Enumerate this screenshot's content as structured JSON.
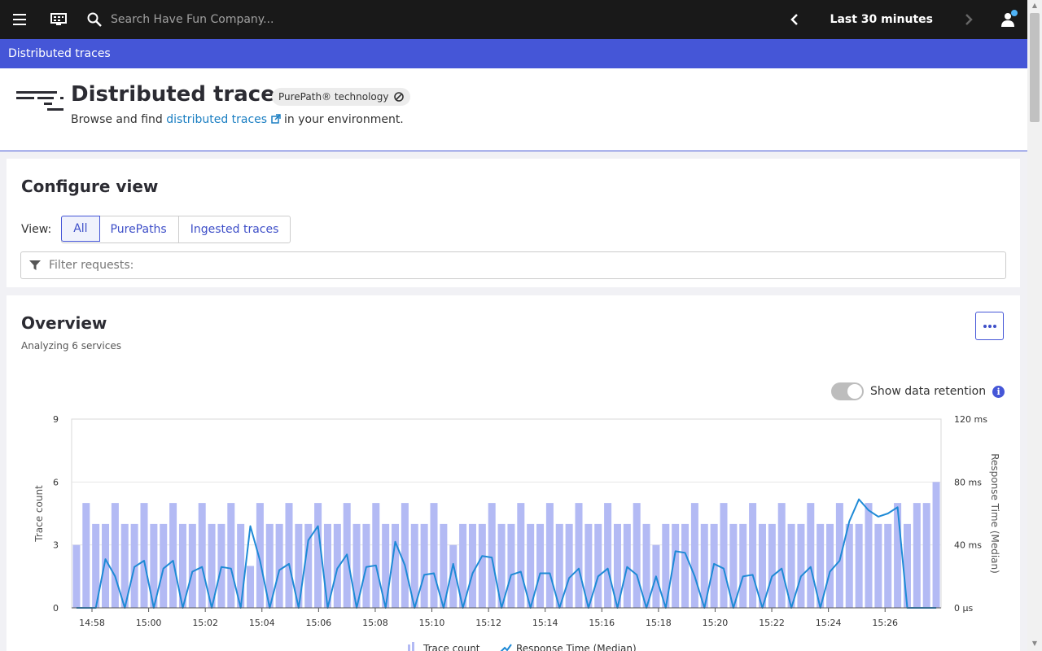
{
  "topbar": {
    "search_placeholder": "Search Have Fun Company...",
    "timeframe": "Last 30 minutes"
  },
  "breadcrumb": {
    "current": "Distributed traces"
  },
  "header": {
    "title": "Distributed traces",
    "badge": "PurePath® technology",
    "subtitle_before": "Browse and find",
    "subtitle_link": "distributed traces",
    "subtitle_after": "in your environment."
  },
  "configure": {
    "title": "Configure view",
    "view_label": "View:",
    "view_options": [
      "All",
      "PurePaths",
      "Ingested traces"
    ],
    "selected": "All",
    "filter_placeholder": "Filter requests:"
  },
  "overview": {
    "title": "Overview",
    "subtitle": "Analyzing 6 services",
    "toggle_label": "Show data retention",
    "toggle_on": false
  },
  "chart_data": {
    "type": "bar",
    "ylabel": "Trace count",
    "y2label": "Response Time (Median)",
    "ylim": [
      0,
      9
    ],
    "yticks": [
      "0",
      "3",
      "6",
      "9"
    ],
    "y2ticks": [
      "0 µs",
      "40 ms",
      "80 ms",
      "120 ms"
    ],
    "xticks": [
      "14:58",
      "15:00",
      "15:02",
      "15:04",
      "15:06",
      "15:08",
      "15:10",
      "15:12",
      "15:14",
      "15:16",
      "15:18",
      "15:20",
      "15:22",
      "15:24",
      "15:26"
    ],
    "grid": true,
    "legend_position": "bottom",
    "colors": {
      "bars": "#b3baf4",
      "line": "#1e8ad6"
    },
    "series": [
      {
        "name": "Trace count",
        "values": [
          3,
          5,
          4,
          4,
          5,
          4,
          4,
          5,
          4,
          4,
          5,
          4,
          4,
          5,
          4,
          4,
          5,
          4,
          2,
          5,
          4,
          4,
          5,
          4,
          4,
          5,
          4,
          4,
          5,
          4,
          4,
          5,
          4,
          4,
          5,
          4,
          4,
          5,
          4,
          3,
          4,
          4,
          4,
          5,
          4,
          4,
          5,
          4,
          4,
          5,
          4,
          4,
          5,
          4,
          4,
          5,
          4,
          4,
          5,
          4,
          3,
          4,
          4,
          4,
          5,
          4,
          4,
          5,
          4,
          4,
          5,
          4,
          4,
          5,
          4,
          4,
          5,
          4,
          4,
          5,
          4,
          4,
          5,
          4,
          4,
          5,
          4,
          5,
          5,
          6
        ]
      },
      {
        "name": "Response Time (Median)",
        "values": [
          0,
          0,
          0,
          31,
          20,
          0,
          26,
          30,
          0,
          25,
          30,
          0,
          23,
          26,
          0,
          26,
          25,
          0,
          52,
          30,
          0,
          24,
          28,
          0,
          43,
          52,
          0,
          25,
          34,
          0,
          26,
          27,
          0,
          42,
          27,
          0,
          21,
          22,
          0,
          28,
          0,
          22,
          33,
          32,
          0,
          21,
          23,
          0,
          22,
          22,
          0,
          19,
          25,
          0,
          20,
          25,
          0,
          26,
          21,
          0,
          20,
          0,
          36,
          35,
          20,
          0,
          28,
          25,
          0,
          20,
          21,
          0,
          20,
          25,
          0,
          20,
          26,
          0,
          23,
          30,
          55,
          69,
          62,
          58,
          60,
          64,
          0,
          0,
          0,
          0
        ]
      }
    ]
  }
}
